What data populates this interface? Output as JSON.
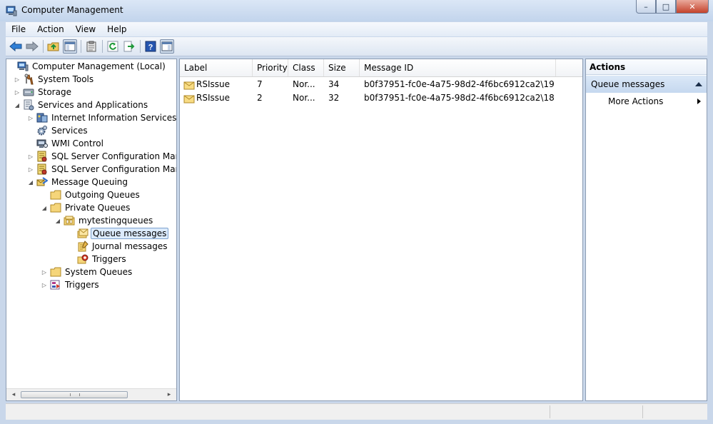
{
  "window": {
    "title": "Computer Management",
    "controls": {
      "minimize": "–",
      "maximize": "□",
      "close": "✕"
    }
  },
  "menu": {
    "items": [
      "File",
      "Action",
      "View",
      "Help"
    ]
  },
  "toolbar": {
    "icons": [
      "back-arrow-icon",
      "forward-arrow-icon",
      "up-folder-icon",
      "show-hide-tree-icon",
      "clipboard-icon",
      "refresh-icon",
      "export-list-icon",
      "help-icon",
      "show-hide-action-pane-icon"
    ]
  },
  "tree": {
    "nodes": [
      {
        "label": "Computer Management (Local)",
        "expander": "",
        "icon": "computer-icon"
      },
      {
        "label": "System Tools",
        "expander": "▷",
        "icon": "tools-icon"
      },
      {
        "label": "Storage",
        "expander": "▷",
        "icon": "storage-icon"
      },
      {
        "label": "Services and Applications",
        "expander": "◢",
        "icon": "services-apps-icon"
      },
      {
        "label": "Internet Information Services (IIS)",
        "expander": "▷",
        "icon": "iis-icon"
      },
      {
        "label": "Services",
        "expander": "",
        "icon": "gear-icon"
      },
      {
        "label": "WMI Control",
        "expander": "",
        "icon": "wmi-icon"
      },
      {
        "label": "SQL Server Configuration Manager",
        "expander": "▷",
        "icon": "sql-config-icon"
      },
      {
        "label": "SQL Server Configuration Manager",
        "expander": "▷",
        "icon": "sql-config-icon"
      },
      {
        "label": "Message Queuing",
        "expander": "◢",
        "icon": "message-queuing-icon"
      },
      {
        "label": "Outgoing Queues",
        "expander": "",
        "icon": "folder-icon"
      },
      {
        "label": "Private Queues",
        "expander": "◢",
        "icon": "folder-icon"
      },
      {
        "label": "mytestingqueues",
        "expander": "◢",
        "icon": "queue-icon"
      },
      {
        "label": "Queue messages",
        "expander": "",
        "icon": "queue-messages-icon",
        "selected": true
      },
      {
        "label": "Journal messages",
        "expander": "",
        "icon": "journal-messages-icon"
      },
      {
        "label": "Triggers",
        "expander": "",
        "icon": "triggers-icon"
      },
      {
        "label": "System Queues",
        "expander": "▷",
        "icon": "folder-icon"
      },
      {
        "label": "Triggers",
        "expander": "▷",
        "icon": "triggers-icon"
      }
    ],
    "scroll_left": "◂",
    "scroll_right": "▸"
  },
  "table": {
    "columns": [
      "Label",
      "Priority",
      "Class",
      "Size",
      "Message ID"
    ],
    "rows": [
      {
        "label": "RSIssue",
        "priority": "7",
        "class": "Nor...",
        "size": "34",
        "message_id": "b0f37951-fc0e-4a75-98d2-4f6bc6912ca2\\19"
      },
      {
        "label": "RSIssue",
        "priority": "2",
        "class": "Nor...",
        "size": "32",
        "message_id": "b0f37951-fc0e-4a75-98d2-4f6bc6912ca2\\18"
      }
    ]
  },
  "actions": {
    "title": "Actions",
    "section": "Queue messages",
    "items": [
      "More Actions"
    ]
  }
}
